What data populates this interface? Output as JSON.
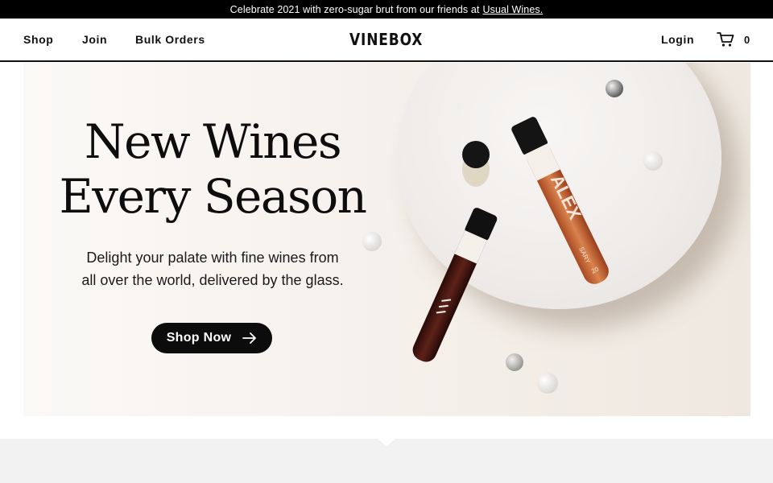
{
  "announcement": {
    "text": "Celebrate 2021 with zero-sugar brut from our friends at",
    "link": "Usual Wines."
  },
  "nav": {
    "left": [
      {
        "label": "Shop"
      },
      {
        "label": "Join"
      },
      {
        "label": "Bulk Orders"
      }
    ],
    "logo": "VINEBOX",
    "login": "Login",
    "cart_count": "0"
  },
  "hero": {
    "title_line1": "New Wines",
    "title_line2": "Every Season",
    "subtitle_line1": "Delight your palate with fine wines from",
    "subtitle_line2": "all over the world, delivered by the glass.",
    "cta": "Shop Now",
    "bottle_label_1": "ALEX",
    "bottle_label_2": "SARY",
    "bottle_year": "20"
  },
  "icons": {
    "cart": "shopping-cart-icon",
    "arrow": "arrow-right-icon"
  },
  "colors": {
    "announcement_bg": "#000000",
    "cta_bg": "#0c0c0c",
    "lower_section_bg": "#f2f2f2",
    "rose_wine": "#c96a3c",
    "red_wine": "#4a1a14"
  }
}
